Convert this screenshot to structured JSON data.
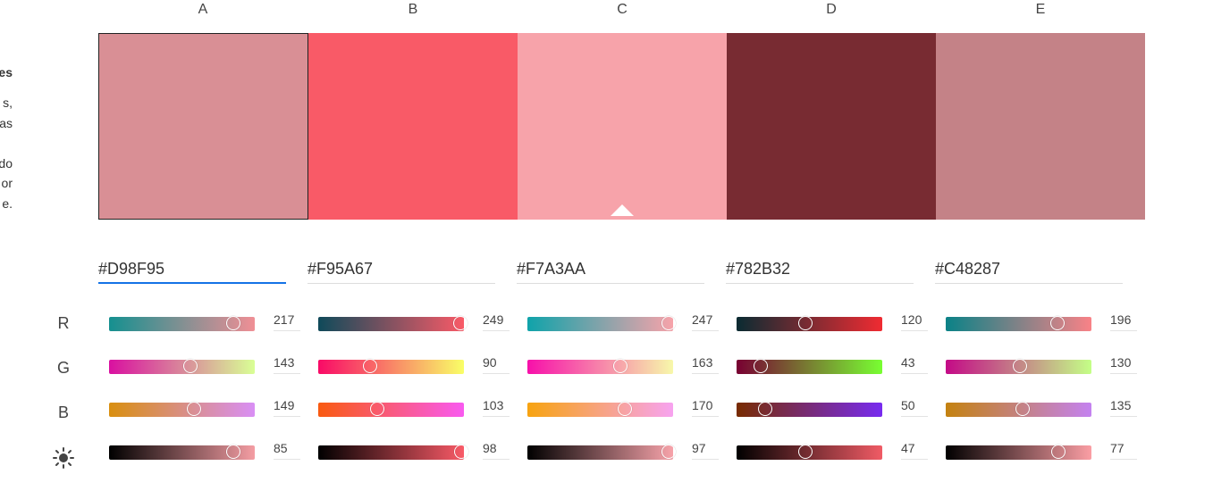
{
  "sidebar": {
    "lines": [
      {
        "text": "es",
        "bold": true
      },
      {
        "text": "s,",
        "bold": false
      },
      {
        "text": "as",
        "bold": false
      },
      {
        "text": "do",
        "bold": false
      },
      {
        "text": "or",
        "bold": false
      },
      {
        "text": "e.",
        "bold": false
      }
    ]
  },
  "row_labels": {
    "r": "R",
    "g": "G",
    "b": "B",
    "brightness_icon": "sun-icon"
  },
  "colors": [
    {
      "letter": "A",
      "hex": "#D98F95",
      "r": 217,
      "g": 143,
      "b": 149,
      "brightness": 85,
      "selected": true,
      "r_grad": [
        "#159090",
        "#f08f95"
      ],
      "g_grad": [
        "#d910a0",
        "#d9ff95"
      ],
      "b_grad": [
        "#d98f10",
        "#d98ff5"
      ],
      "br_grad": [
        "#000000",
        "#f49da3"
      ]
    },
    {
      "letter": "B",
      "hex": "#F95A67",
      "r": 249,
      "g": 90,
      "b": 103,
      "brightness": 98,
      "selected": false,
      "r_grad": [
        "#0f4a5a",
        "#f95a67"
      ],
      "g_grad": [
        "#f90a67",
        "#f9ff67"
      ],
      "b_grad": [
        "#f95a10",
        "#f95af0"
      ],
      "br_grad": [
        "#000000",
        "#f95a67"
      ]
    },
    {
      "letter": "C",
      "hex": "#F7A3AA",
      "r": 247,
      "g": 163,
      "b": 170,
      "brightness": 97,
      "selected": false,
      "caret": true,
      "r_grad": [
        "#0fa3aa",
        "#f7a3aa"
      ],
      "g_grad": [
        "#f710aa",
        "#f7f8aa"
      ],
      "b_grad": [
        "#f7a310",
        "#f7a3f0"
      ],
      "br_grad": [
        "#000000",
        "#f7a3aa"
      ]
    },
    {
      "letter": "D",
      "hex": "#782B32",
      "r": 120,
      "g": 43,
      "b": 50,
      "brightness": 47,
      "selected": false,
      "r_grad": [
        "#0a2b32",
        "#f02b32"
      ],
      "g_grad": [
        "#780032",
        "#78ff32"
      ],
      "b_grad": [
        "#782b00",
        "#782bf0"
      ],
      "br_grad": [
        "#000000",
        "#f05b65"
      ]
    },
    {
      "letter": "E",
      "hex": "#C48287",
      "r": 196,
      "g": 130,
      "b": 135,
      "brightness": 77,
      "selected": false,
      "r_grad": [
        "#0a8287",
        "#f98287"
      ],
      "g_grad": [
        "#c40a87",
        "#c4ff87"
      ],
      "b_grad": [
        "#c48210",
        "#c482f0"
      ],
      "br_grad": [
        "#000000",
        "#fb9ea4"
      ]
    }
  ]
}
